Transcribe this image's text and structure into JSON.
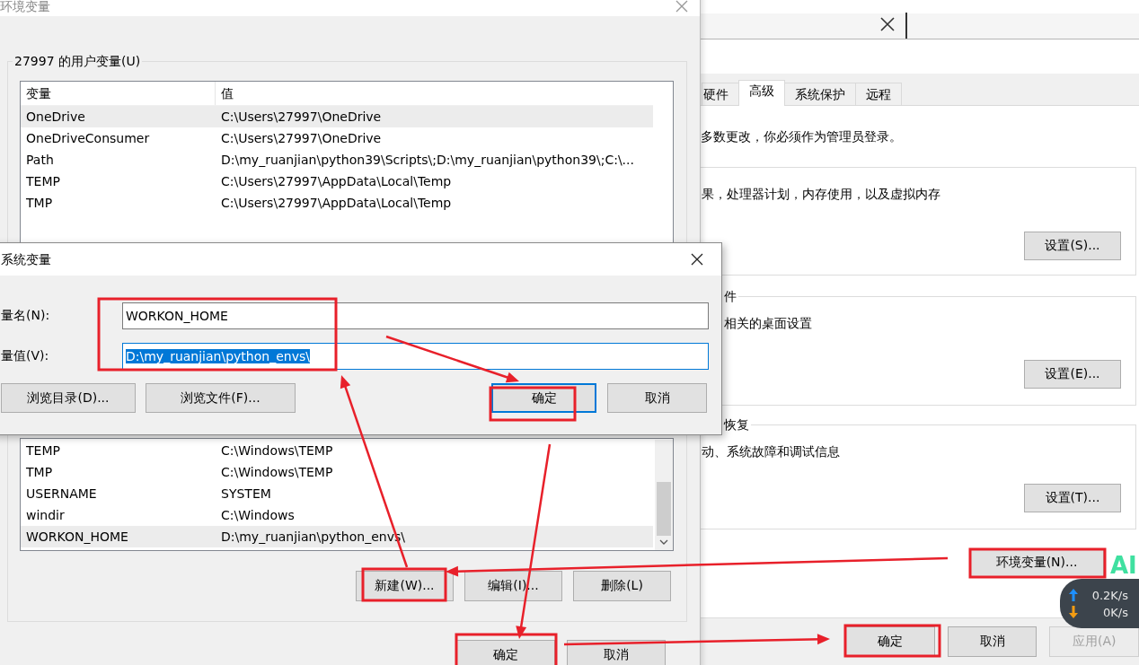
{
  "system_properties": {
    "tabs": [
      {
        "label": "硬件",
        "selected": false
      },
      {
        "label": "高级",
        "selected": true
      },
      {
        "label": "系统保护",
        "selected": false
      },
      {
        "label": "远程",
        "selected": false
      }
    ],
    "admin_note": "多数更改，你必须作为管理员登录。",
    "sections": [
      {
        "description": "果，处理器计划，内存使用，以及虚拟内存",
        "button": "设置(S)..."
      },
      {
        "title": "件",
        "description": "相关的桌面设置",
        "button": "设置(E)..."
      },
      {
        "title": "恢复",
        "description": "动、系统故障和调试信息",
        "button": "设置(T)..."
      }
    ],
    "env_button": "环境变量(N)...",
    "buttons": [
      {
        "label": "确定",
        "disabled": false
      },
      {
        "label": "取消",
        "disabled": false
      },
      {
        "label": "应用(A)",
        "disabled": true
      }
    ]
  },
  "environment_window": {
    "title": "环境变量",
    "user_group": "27997 的用户变量(U)",
    "columns": [
      "变量",
      "值"
    ],
    "user_rows": [
      {
        "name": "OneDrive",
        "value": "C:\\Users\\27997\\OneDrive",
        "selected": true
      },
      {
        "name": "OneDriveConsumer",
        "value": "C:\\Users\\27997\\OneDrive",
        "selected": false
      },
      {
        "name": "Path",
        "value": "D:\\my_ruanjian\\python39\\Scripts\\;D:\\my_ruanjian\\python39\\;C:\\...",
        "selected": false
      },
      {
        "name": "TEMP",
        "value": "C:\\Users\\27997\\AppData\\Local\\Temp",
        "selected": false
      },
      {
        "name": "TMP",
        "value": "C:\\Users\\27997\\AppData\\Local\\Temp",
        "selected": false
      }
    ],
    "system_rows": [
      {
        "name": "TEMP",
        "value": "C:\\Windows\\TEMP",
        "selected": false
      },
      {
        "name": "TMP",
        "value": "C:\\Windows\\TEMP",
        "selected": false
      },
      {
        "name": "USERNAME",
        "value": "SYSTEM",
        "selected": false
      },
      {
        "name": "windir",
        "value": "C:\\Windows",
        "selected": false
      },
      {
        "name": "WORKON_HOME",
        "value": "D:\\my_ruanjian\\python_envs\\",
        "selected": true
      }
    ],
    "system_buttons": [
      "新建(W)...",
      "编辑(I)...",
      "删除(L)"
    ],
    "buttons": [
      "确定",
      "取消"
    ]
  },
  "edit_dialog": {
    "title": "系统变量",
    "fields": [
      {
        "label": "量名(N):",
        "value": "WORKON_HOME",
        "highlighted": false
      },
      {
        "label": "量值(V):",
        "value": "D:\\my_ruanjian\\python_envs\\",
        "highlighted": true
      }
    ],
    "buttons": [
      {
        "label": "浏览目录(D)...",
        "default": false
      },
      {
        "label": "浏览文件(F)...",
        "default": false
      },
      {
        "label": "确定",
        "default": true
      },
      {
        "label": "取消",
        "default": false
      }
    ]
  },
  "network_speed": {
    "upload": "0.2K/s",
    "download": "0K/s"
  },
  "logo_text": "AI"
}
